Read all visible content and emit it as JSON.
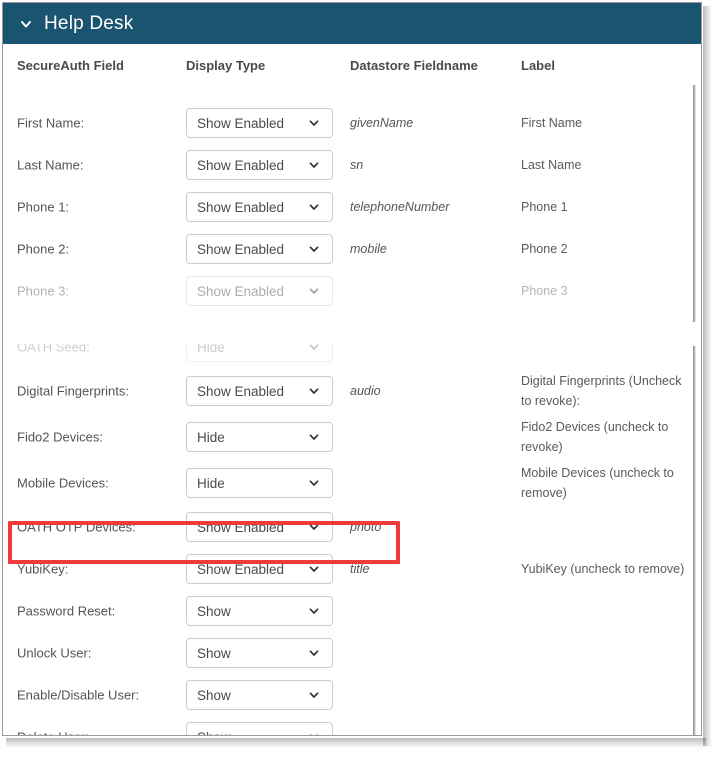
{
  "panel": {
    "title": "Help Desk",
    "collapse_icon": "chevron-down-icon",
    "header_color": "#1b5470",
    "highlight_color": "#ef3b3b"
  },
  "columns": [
    {
      "key": "field",
      "label": "SecureAuth Field"
    },
    {
      "key": "display",
      "label": "Display Type"
    },
    {
      "key": "datastore",
      "label": "Datastore Fieldname"
    },
    {
      "key": "label",
      "label": "Label"
    }
  ],
  "select_caret_icon": "chevron-down-icon",
  "rows": [
    {
      "field": "First Name:",
      "display": "Show Enabled",
      "datastore": "givenName",
      "label": "First Name",
      "state": "normal"
    },
    {
      "field": "Last Name:",
      "display": "Show Enabled",
      "datastore": "sn",
      "label": "Last Name",
      "state": "normal"
    },
    {
      "field": "Phone 1:",
      "display": "Show Enabled",
      "datastore": "telephoneNumber",
      "label": "Phone 1",
      "state": "normal"
    },
    {
      "field": "Phone 2:",
      "display": "Show Enabled",
      "datastore": "mobile",
      "label": "Phone 2",
      "state": "normal"
    },
    {
      "field": "Phone 3:",
      "display": "Show Enabled",
      "datastore": "",
      "label": "Phone 3",
      "state": "faded-1"
    },
    {
      "field": "OATH Seed:",
      "display": "Hide",
      "datastore": "",
      "label": "",
      "state": "faded-2"
    },
    {
      "field": "Digital Fingerprints:",
      "display": "Show Enabled",
      "datastore": "audio",
      "label": "Digital Fingerprints (Uncheck to revoke):",
      "state": "normal"
    },
    {
      "field": "Fido2 Devices:",
      "display": "Hide",
      "datastore": "",
      "label": "Fido2 Devices (uncheck to revoke)",
      "state": "normal"
    },
    {
      "field": "Mobile Devices:",
      "display": "Hide",
      "datastore": "",
      "label": "Mobile Devices (uncheck to remove)",
      "state": "normal"
    },
    {
      "field": "OATH OTP Devices:",
      "display": "Show Enabled",
      "datastore": "photo",
      "label": "",
      "state": "normal",
      "highlighted": true
    },
    {
      "field": "YubiKey:",
      "display": "Show Enabled",
      "datastore": "title",
      "label": "YubiKey (uncheck to remove)",
      "state": "normal"
    },
    {
      "field": "Password Reset:",
      "display": "Show",
      "datastore": "",
      "label": "",
      "state": "normal"
    },
    {
      "field": "Unlock User:",
      "display": "Show",
      "datastore": "",
      "label": "",
      "state": "normal"
    },
    {
      "field": "Enable/Disable User:",
      "display": "Show",
      "datastore": "",
      "label": "",
      "state": "normal"
    },
    {
      "field": "Delete User:",
      "display": "Show",
      "datastore": "",
      "label": "",
      "state": "normal"
    }
  ]
}
